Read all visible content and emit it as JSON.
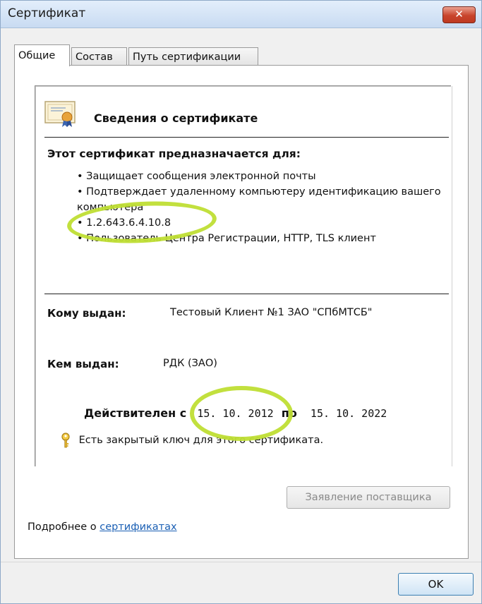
{
  "window": {
    "title": "Сертификат"
  },
  "tabs": [
    {
      "label": "Общие",
      "active": true
    },
    {
      "label": "Состав",
      "active": false
    },
    {
      "label": "Путь сертификации",
      "active": false
    }
  ],
  "info": {
    "heading": "Сведения о сертификате",
    "purpose_heading": "Этот сертификат предназначается для:",
    "purposes": [
      "Защищает сообщения электронной почты",
      "Подтверждает удаленному компьютеру идентификацию вашего компьютера",
      "1.2.643.6.4.10.8",
      "Пользователь Центра Регистрации, HTTP, TLS клиент"
    ],
    "issued_to_label": "Кому выдан:",
    "issued_to_value": "Тестовый Клиент №1 ЗАО \"СПбМТСБ\"",
    "issued_by_label": "Кем выдан:",
    "issued_by_value": "РДК (ЗАО)",
    "valid_from_label": "Действителен с",
    "valid_from": "15. 10. 2012",
    "valid_to_label": "по",
    "valid_to": "15. 10. 2022",
    "private_key_text": "Есть закрытый ключ для этого сертификата."
  },
  "buttons": {
    "provider_statement": "Заявление поставщика",
    "ok": "OK",
    "close": "✕"
  },
  "footer": {
    "more_info_prefix": "Подробнее о ",
    "more_info_link": "сертификатах"
  },
  "colors": {
    "highlight_circle": "#bfde34",
    "link": "#1a5fb4",
    "close_button": "#c8442c"
  },
  "icons": {
    "certificate": "certificate-icon",
    "key": "key-icon"
  }
}
